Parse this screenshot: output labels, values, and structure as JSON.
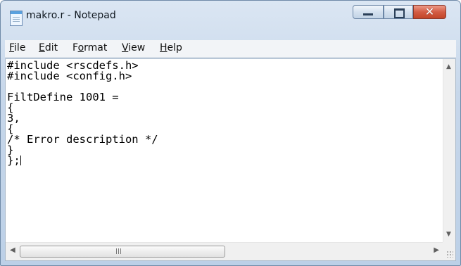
{
  "window": {
    "title": "makro.r - Notepad",
    "accent_color": "#c24528"
  },
  "caption_buttons": {
    "minimize": "minimize-icon",
    "maximize": "maximize-icon",
    "close": "close-icon",
    "close_glyph": "✕"
  },
  "menu": {
    "items": [
      {
        "key": "F",
        "rest": "ile"
      },
      {
        "key": "E",
        "rest": "dit"
      },
      {
        "key": "o",
        "pre": "F",
        "rest": "rmat"
      },
      {
        "key": "V",
        "rest": "iew"
      },
      {
        "key": "H",
        "rest": "elp"
      }
    ]
  },
  "editor": {
    "lines": [
      "#include <rscdefs.h>",
      "#include <config.h>",
      "",
      "FiltDefine 1001 =",
      "{",
      "3,",
      "{",
      "/* Error description */",
      "}",
      "};"
    ]
  },
  "scrollbars": {
    "up": "▲",
    "down": "▼",
    "left": "◀",
    "right": "▶"
  }
}
